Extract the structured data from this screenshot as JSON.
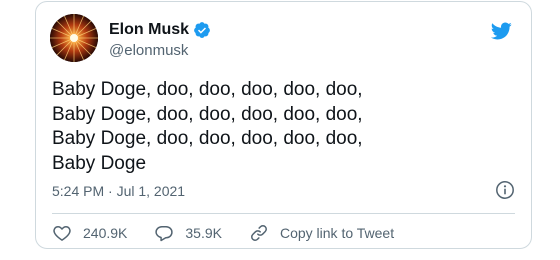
{
  "tweet": {
    "author": {
      "display_name": "Elon Musk",
      "handle": "@elonmusk",
      "verified": true,
      "avatar_icon": "avatar-starburst"
    },
    "text": "Baby Doge, doo, doo, doo, doo, doo,\nBaby Doge, doo, doo, doo, doo, doo,\nBaby Doge, doo, doo, doo, doo, doo,\nBaby Doge",
    "timestamp": "5:24 PM · Jul 1, 2021",
    "actions": {
      "likes": "240.9K",
      "replies": "35.9K",
      "copy_link_label": "Copy link to Tweet"
    }
  },
  "colors": {
    "brand": "#1d9bf0",
    "text": "#0f1419",
    "secondary": "#536471",
    "border": "#cfd9de"
  },
  "icons": [
    "twitter-bird-icon",
    "verified-badge-icon",
    "info-icon",
    "heart-icon",
    "reply-icon",
    "link-icon"
  ]
}
